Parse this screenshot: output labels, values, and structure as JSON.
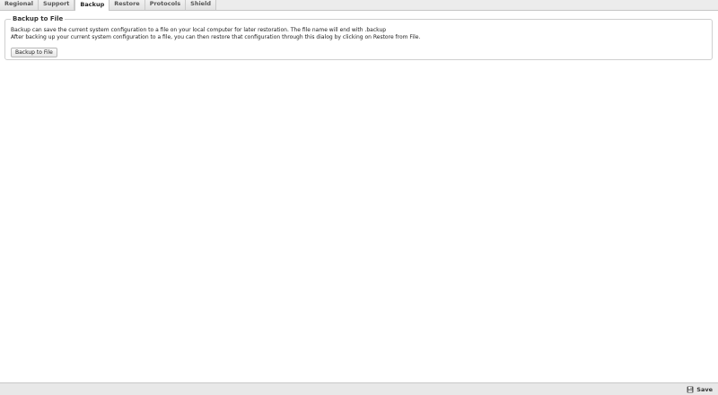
{
  "tabs": [
    {
      "label": "Regional",
      "active": false
    },
    {
      "label": "Support",
      "active": false
    },
    {
      "label": "Backup",
      "active": true
    },
    {
      "label": "Restore",
      "active": false
    },
    {
      "label": "Protocols",
      "active": false
    },
    {
      "label": "Shield",
      "active": false
    }
  ],
  "backup_section": {
    "title": "Backup to File",
    "line1": "Backup can save the current system configuration to a file on your local computer for later restoration. The file name will end with .backup",
    "line2": "After backing up your current system configuration to a file, you can then restore that configuration through this dialog by clicking on Restore from File.",
    "button_label": "Backup to File"
  },
  "footer": {
    "save_label": "Save",
    "save_icon": "floppy-disk-icon"
  }
}
